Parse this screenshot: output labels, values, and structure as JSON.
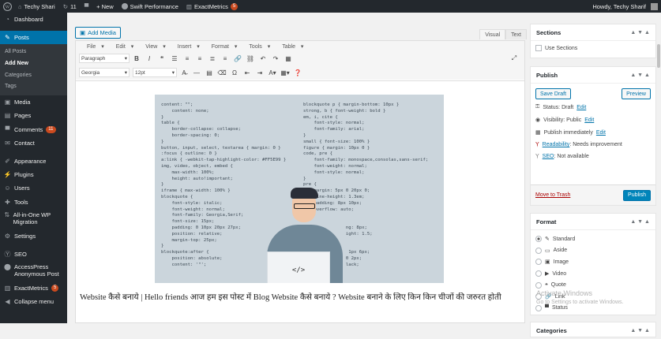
{
  "adminbar": {
    "site_name": "Techy Shari",
    "updates": "11",
    "new_label": "+ New",
    "swift_label": "Swift Performance",
    "exactmetrics_label": "ExactMetrics",
    "exactmetrics_badge": "5",
    "howdy": "Howdy, Techy Sharif"
  },
  "sidebar": {
    "items": [
      {
        "icon": "dashboard-icon",
        "label": "Dashboard"
      },
      {
        "icon": "pin-icon",
        "label": "Posts"
      },
      {
        "icon": "media-icon",
        "label": "Media"
      },
      {
        "icon": "pages-icon",
        "label": "Pages"
      },
      {
        "icon": "comments-icon",
        "label": "Comments",
        "badge": "11"
      },
      {
        "icon": "contact-icon",
        "label": "Contact"
      },
      {
        "icon": "appearance-icon",
        "label": "Appearance"
      },
      {
        "icon": "plugins-icon",
        "label": "Plugins"
      },
      {
        "icon": "users-icon",
        "label": "Users"
      },
      {
        "icon": "tools-icon",
        "label": "Tools"
      },
      {
        "icon": "migration-icon",
        "label": "All-in-One WP Migration"
      },
      {
        "icon": "settings-icon",
        "label": "Settings"
      },
      {
        "icon": "seo-icon",
        "label": "SEO"
      },
      {
        "icon": "access-icon",
        "label": "AccessPress Anonymous Post"
      },
      {
        "icon": "exactmetrics-icon",
        "label": "ExactMetrics",
        "badge": "5"
      },
      {
        "icon": "collapse-icon",
        "label": "Collapse menu"
      }
    ],
    "posts_sub": [
      "All Posts",
      "Add New",
      "Categories",
      "Tags"
    ]
  },
  "editor": {
    "add_media": "Add Media",
    "tab_visual": "Visual",
    "tab_text": "Text",
    "menus": [
      "File",
      "Edit",
      "View",
      "Insert",
      "Format",
      "Tools",
      "Table"
    ],
    "format_select": "Paragraph",
    "font_select": "Georgia",
    "size_select": "12pt",
    "code_left": "content: \"\";\n    content: none;\n}\ntable {\n    border-collapse: collapse;\n    border-spacing: 0;\n}\nbutton, input, select, textarea { margin: 0 }\n:focus { outline: 0 }\na:link { -webkit-tap-highlight-color: #FF5E99 }\nimg, video, object, embed {\n    max-width: 100%;\n    height: auto!important;\n}\niframe { max-width: 100% }\nblockquote {\n    font-style: italic;\n    font-weight: normal;\n    font-family: Georgia,Serif;\n    font-size: 15px;\n    padding: 0 10px 20px 27px;\n    position: relative;\n    margin-top: 25px;\n}\nblockquote:after {\n    position: absolute;\n    content: '\"';",
    "code_right": "blockquote p { margin-bottom: 10px }\nstrong, b { font-weight: bold }\nem, i, cite {\n    font-style: normal;\n    font-family: arial;\n}\nsmall { font-size: 100% }\nfigure { margin: 10px 0 }\ncode, pre {\n    font-family: monospace,consolas,sans-serif;\n    font-weight: normal;\n    font-style: normal;\n}\npre {\n    margin: 5px 0 20px 0;\n    line-height: 1.3em;\n    padding: 8px 10px;\n    overflow: auto;\n}\n\n                ng: 8px;\n                ight: 1.5;\n\n\n                 1px 6px;\n                0 2px;\n                lack;",
    "laptop_code": "</>",
    "paragraph": "Website कैसे बनाये | Hello friends आज हम इस पोस्ट में Blog Website कैसे बनाये ? Website बनाने के लिए किन किन चीजों की जरुरत होती"
  },
  "sections_box": {
    "title": "Sections",
    "option": "Use Sections"
  },
  "publish_box": {
    "title": "Publish",
    "save_draft": "Save Draft",
    "preview": "Preview",
    "status_label": "Status: Draft",
    "visibility_label": "Visibility: Public",
    "publish_label": "Publish immediately",
    "edit": "Edit",
    "readability_link": "Readability",
    "readability_value": ": Needs improvement",
    "seo_link": "SEO",
    "seo_value": ": Not available",
    "trash": "Move to Trash",
    "publish_btn": "Publish"
  },
  "format_box": {
    "title": "Format",
    "options": [
      "Standard",
      "Aside",
      "Image",
      "Video",
      "Quote",
      "Link",
      "Status"
    ],
    "selected": "Standard"
  },
  "categories_box": {
    "title": "Categories"
  },
  "watermark": {
    "line1": "Activate Windows",
    "line2": "Go to Settings to activate Windows."
  },
  "colors": {
    "adminbar": "#23282d",
    "accent": "#0073aa",
    "badge": "#ca4a1f"
  }
}
